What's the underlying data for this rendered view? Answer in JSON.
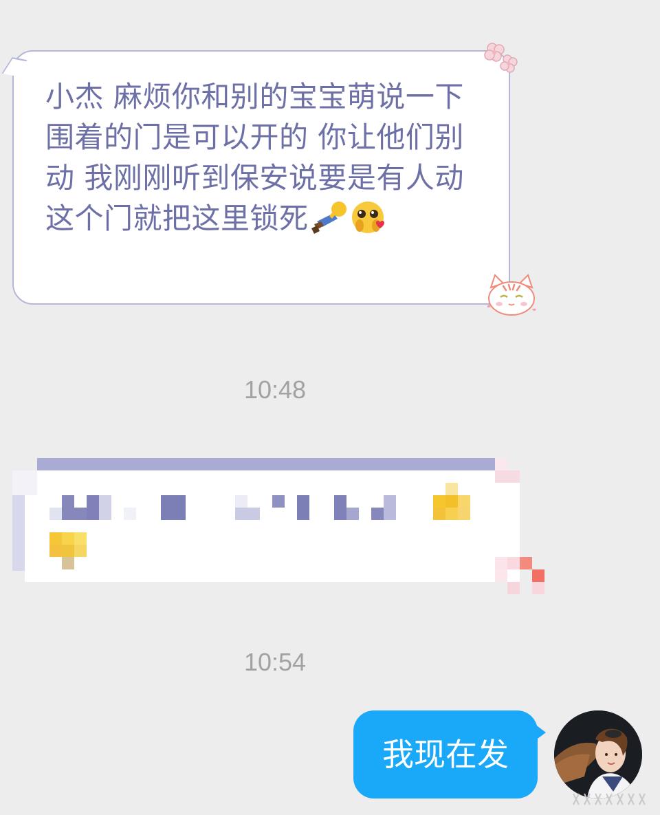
{
  "messages": [
    {
      "side": "incoming",
      "text": "小杰 麻烦你和别的宝宝萌说一下 围着的门是可以开的 你让他们别动 我刚刚听到保安说要是有人动这个门就把这里锁死",
      "trailing_emojis": [
        "man-lying-down-icon",
        "pleading-face-hands-icon"
      ]
    },
    {
      "side": "incoming",
      "pixelated": true
    }
  ],
  "timestamps": [
    "10:48",
    "10:54"
  ],
  "outgoing": {
    "text": "我现在发"
  },
  "colors": {
    "background": "#ededed",
    "incoming_text": "#6d70a6",
    "incoming_border": "#b4b6dc",
    "outgoing_bubble": "#1aa8f8",
    "timestamp": "#a2a2a2"
  }
}
